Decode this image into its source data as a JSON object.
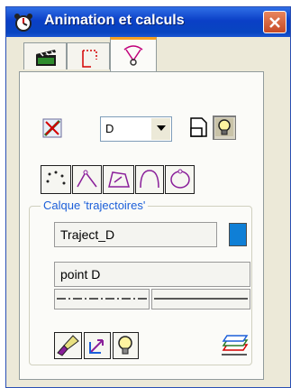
{
  "window": {
    "title": "Animation et calculs"
  },
  "tabs": [
    {
      "id": "animation",
      "icon": "clapperboard-icon"
    },
    {
      "id": "points",
      "icon": "dotted-corner-icon"
    },
    {
      "id": "trajectories",
      "icon": "trajectory-icon",
      "active": true
    }
  ],
  "controls": {
    "point_select": {
      "value": "D"
    },
    "trajectory_types": [
      "dots",
      "polyline-arcs",
      "polygon",
      "arc-curve",
      "closed-loop"
    ]
  },
  "group": {
    "title": "Calque 'trajectoires'",
    "trajectory_name": "Traject_D",
    "color": "#0f7fd6",
    "point_label": "point D",
    "line_styles": [
      "dash-dot",
      "solid"
    ]
  }
}
